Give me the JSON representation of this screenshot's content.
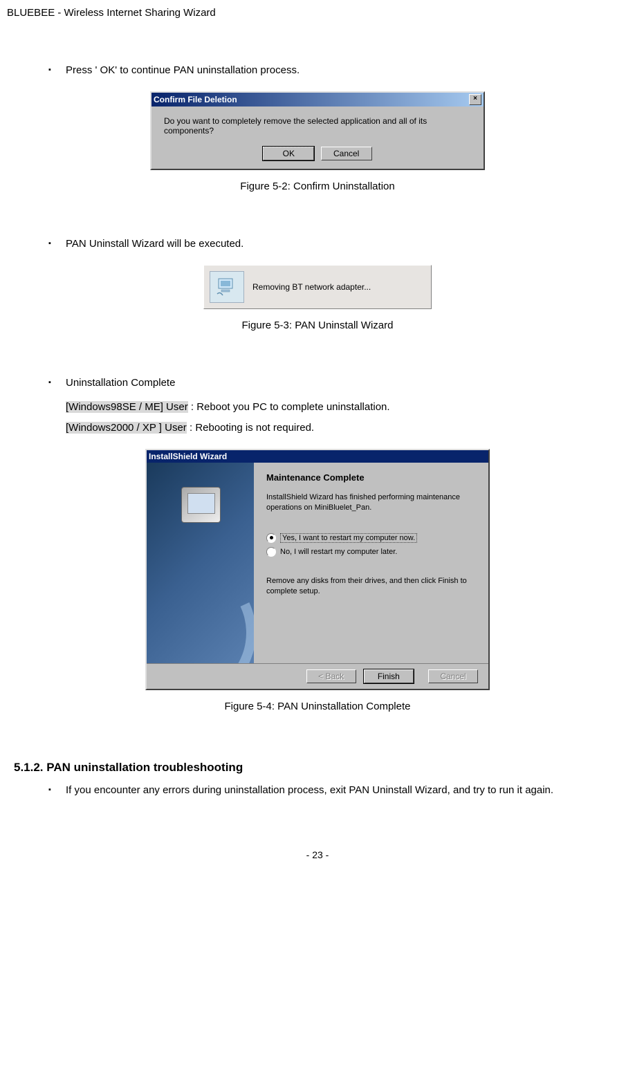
{
  "header": "BLUEBEE - Wireless Internet Sharing Wizard",
  "bullet1": "Press ' OK'  to continue PAN uninstallation process.",
  "dialog1": {
    "title": "Confirm File Deletion",
    "text": "Do you want to completely remove the selected application and all of its components?",
    "ok": "OK",
    "cancel": "Cancel"
  },
  "caption1": "Figure 5-2: Confirm Uninstallation",
  "bullet2": "PAN Uninstall Wizard will be executed.",
  "progress_text": "Removing BT network adapter...",
  "caption2": "Figure 5-3: PAN Uninstall Wizard",
  "bullet3": "Uninstallation  Complete",
  "user98_label": "[Windows98SE / ME] User",
  "user98_text": " : Reboot you PC to complete uninstallation.",
  "user2k_label": "[Windows2000 / XP ] User",
  "user2k_text": " : Rebooting is not required.",
  "wizard": {
    "title": "InstallShield Wizard",
    "heading": "Maintenance Complete",
    "para": "InstallShield Wizard has finished performing maintenance operations on MiniBluelet_Pan.",
    "radio_yes": "Yes, I want to restart my computer now.",
    "radio_no": "No, I will restart my computer later.",
    "para2": "Remove any disks from their drives, and then click Finish to complete setup.",
    "back": "< Back",
    "finish": "Finish",
    "cancel": "Cancel"
  },
  "caption3": "Figure 5-4: PAN Uninstallation Complete",
  "section_heading": "5.1.2. PAN uninstallation troubleshooting",
  "bullet4": "If you encounter any errors during uninstallation  process, exit PAN Uninstall Wizard, and try to run it again.",
  "page_num": "- 23 -"
}
